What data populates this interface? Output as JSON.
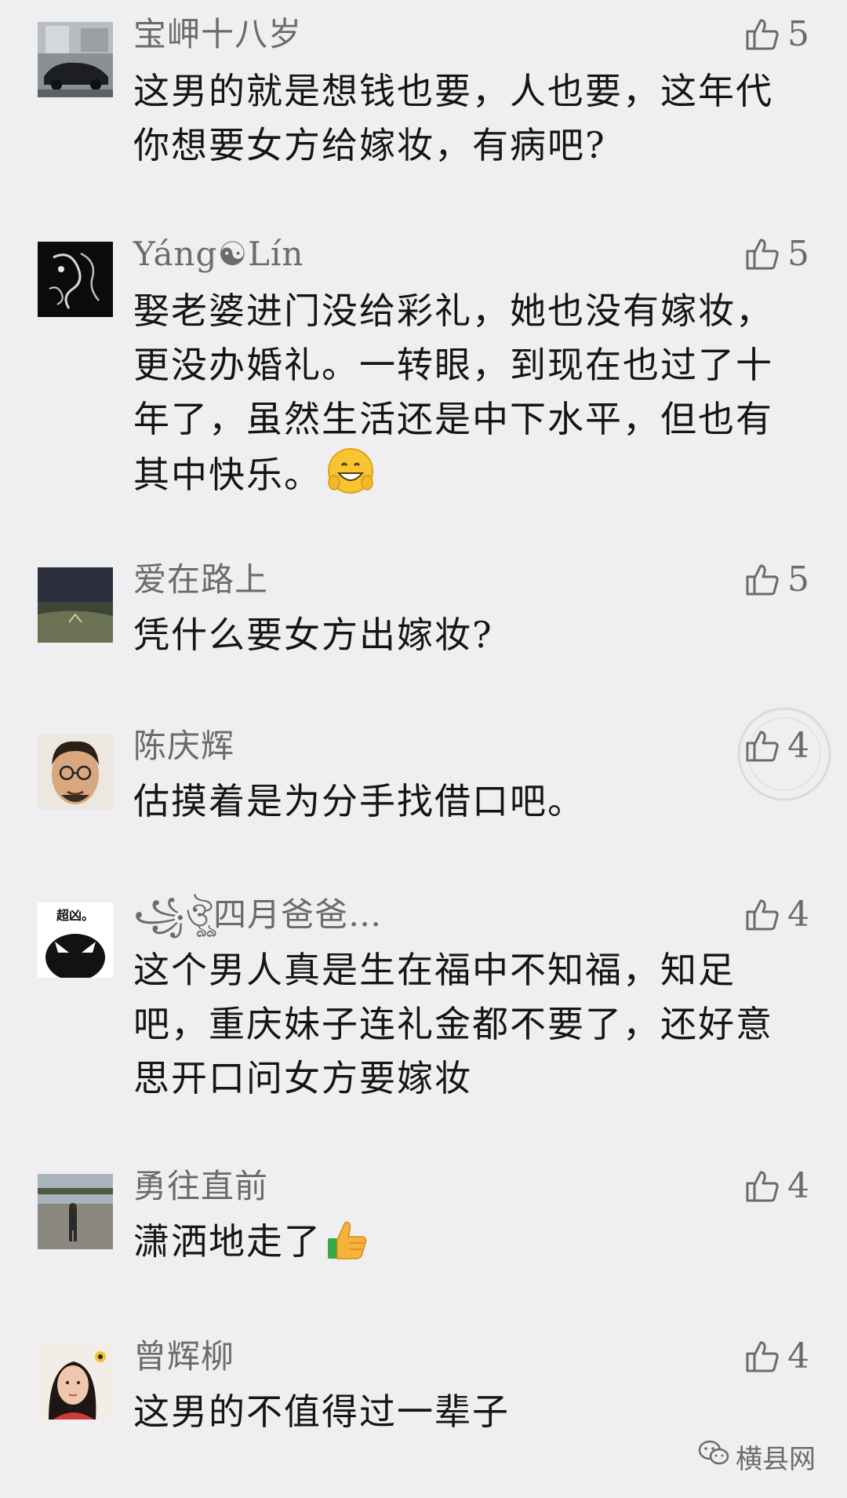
{
  "comments": [
    {
      "name": "宝岬十八岁",
      "likes": "5",
      "text": "这男的就是想钱也要，人也要，这年代你想要女方给嫁妆，有病吧?",
      "avatar": "car-photo-avatar"
    },
    {
      "name": "Yáng☯Lín",
      "likes": "5",
      "text": "娶老婆进门没给彩礼，她也没有嫁妆，更没办婚礼。一转眼，到现在也过了十年了，虽然生活还是中下水平，但也有其中快乐。",
      "emoji": "grin-emoji",
      "avatar": "dragon-art-avatar"
    },
    {
      "name": "爱在路上",
      "likes": "5",
      "text": "凭什么要女方出嫁妆?",
      "avatar": "road-photo-avatar"
    },
    {
      "name": "陈庆辉",
      "likes": "4",
      "text": "估摸着是为分手找借口吧。",
      "avatar": "man-photo-avatar"
    },
    {
      "name": "꧁ঔৣ四月爸爸…",
      "likes": "4",
      "text": "这个男人真是生在福中不知福，知足吧，重庆妹子连礼金都不要了，还好意思开口问女方要嫁妆",
      "avatar": "cartoon-avatar",
      "avatar_caption": "超凶。"
    },
    {
      "name": "勇往直前",
      "likes": "4",
      "text": "潇洒地走了",
      "emoji": "thumbs-up-emoji",
      "avatar": "square-photo-avatar"
    },
    {
      "name": "曾辉柳",
      "likes": "4",
      "text": "这男的不值得过一辈子",
      "avatar": "woman-photo-avatar"
    }
  ],
  "watermark": {
    "label": "横县网",
    "icon": "wechat-icon"
  },
  "colors": {
    "background": "#efeff1",
    "name": "#6b6b6b",
    "text": "#151515"
  }
}
